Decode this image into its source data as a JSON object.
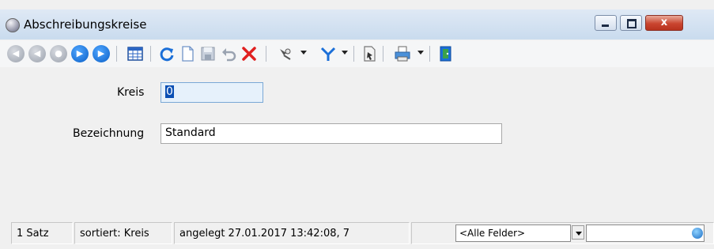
{
  "window": {
    "title": "Abschreibungskreise",
    "close_glyph": "x"
  },
  "toolbar": {
    "icons": [
      "first-record-icon",
      "previous-page-icon",
      "previous-record-icon",
      "next-record-icon",
      "last-record-icon",
      "table-view-icon",
      "refresh-icon",
      "new-record-icon",
      "save-icon",
      "undo-icon",
      "delete-icon",
      "pin-icon",
      "filter-icon",
      "export-icon",
      "print-icon",
      "exit-icon"
    ]
  },
  "form": {
    "kreis_label": "Kreis",
    "kreis_value": "0",
    "bezeichnung_label": "Bezeichnung",
    "bezeichnung_value": "Standard"
  },
  "status": {
    "count": "1 Satz",
    "sort": "sortiert: Kreis",
    "created": "angelegt 27.01.2017 13:42:08,  7",
    "field_filter": "<Alle Felder>",
    "search_value": ""
  },
  "colors": {
    "accent": "#0a5fc7",
    "delete": "#e02020",
    "focus_field": "#e6f1fb"
  }
}
